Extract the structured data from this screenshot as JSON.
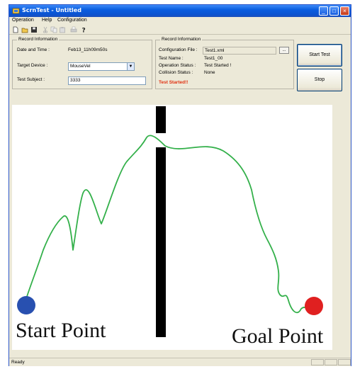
{
  "window": {
    "title": "ScrnTest - Untitled"
  },
  "menu": [
    "Operation",
    "Help",
    "Configuration"
  ],
  "toolbar_icons": [
    "new-icon",
    "open-icon",
    "save-icon",
    "cut-icon",
    "copy-icon",
    "paste-icon",
    "print-icon",
    "help-icon"
  ],
  "record_left": {
    "group_title": "Record Information",
    "date_label": "Date and Time :",
    "date_value": "Feb13_11h09m50s",
    "device_label": "Target Device :",
    "device_value": "MouseVel",
    "subject_label": "Test Subject :",
    "subject_value": "3333"
  },
  "record_right": {
    "group_title": "Record Information",
    "config_label": "Configuration File :",
    "config_value": "Test1.xml",
    "browse_label": "...",
    "name_label": "Test Name :",
    "name_value": "Test1_00",
    "op_label": "Operation Status :",
    "op_value": "Test Started !",
    "collision_label": "Collision Status :",
    "collision_value": "None",
    "started_text": "Test Started!!"
  },
  "buttons": {
    "start": "Start Test",
    "stop": "Stop"
  },
  "canvas": {
    "start_label": "Start Point",
    "goal_label": "Goal Point",
    "colors": {
      "start": "#2850b0",
      "goal": "#e02020",
      "path": "#33b04a",
      "wall": "#000000"
    }
  },
  "status": {
    "text": "Ready"
  }
}
